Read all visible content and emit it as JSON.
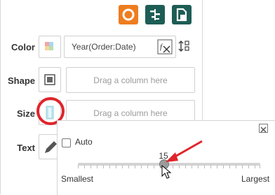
{
  "toolbar": {
    "buttons": [
      {
        "icon": "donut-chart-icon",
        "color": "#ee7d1f"
      },
      {
        "icon": "gantt-chart-icon",
        "color": "#1d5d55"
      },
      {
        "icon": "layout-chart-icon",
        "color": "#1d5d55"
      }
    ]
  },
  "fields": {
    "color": {
      "label": "Color",
      "value": "Year(Order:Date)"
    },
    "shape": {
      "label": "Shape",
      "placeholder": "Drag a column here"
    },
    "size": {
      "label": "Size",
      "placeholder": "Drag a column here"
    },
    "text": {
      "label": "Text"
    }
  },
  "size_popup": {
    "auto_label": "Auto",
    "auto_checked": false,
    "slider_value": "15",
    "min_label": "Smallest",
    "max_label": "Largest"
  },
  "annotation_colors": {
    "highlight": "#e0242a"
  }
}
